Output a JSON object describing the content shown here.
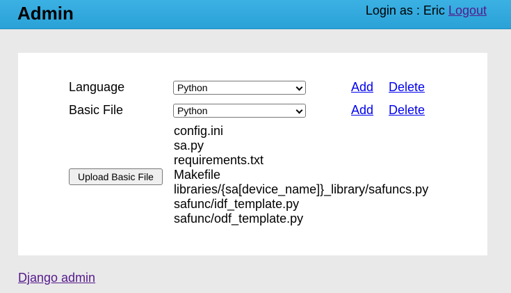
{
  "header": {
    "title": "Admin",
    "login_prefix": "Login as : Eric",
    "logout_label": "Logout"
  },
  "form": {
    "language": {
      "label": "Language",
      "selected": "Python",
      "add_label": "Add",
      "delete_label": "Delete"
    },
    "basic_file": {
      "label": "Basic File",
      "selected": "Python",
      "add_label": "Add",
      "delete_label": "Delete"
    },
    "upload_button_label": "Upload Basic File",
    "files": [
      "config.ini",
      "sa.py",
      "requirements.txt",
      "Makefile",
      "libraries/{sa[device_name]}_library/safuncs.py",
      "safunc/idf_template.py",
      "safunc/odf_template.py"
    ]
  },
  "footer": {
    "django_admin_label": "Django admin"
  },
  "colors": {
    "header_bg": "#2aa2d7",
    "page_bg": "#e9e9e9",
    "link": "#0000ee",
    "visited_link": "#551a8b"
  }
}
